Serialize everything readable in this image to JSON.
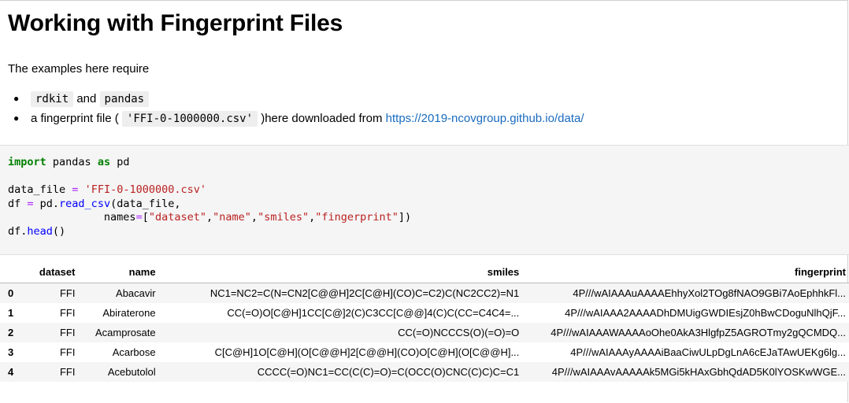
{
  "notebook": {
    "title": "Working with Fingerprint Files",
    "intro": "The examples here require",
    "requirements": {
      "item1": {
        "code1": "rdkit",
        "text1": " and ",
        "code2": "pandas"
      },
      "item2": {
        "text1": "a fingerprint file (",
        "code": "'FFI-0-1000000.csv'",
        "text2": ")here downloaded from ",
        "link": "https://2019-ncovgroup.github.io/data/"
      }
    }
  },
  "code_cell": {
    "line1": {
      "kw_import": "import",
      "mod": " pandas ",
      "kw_as": "as",
      "alias": " pd"
    },
    "line3": {
      "var": "data_file ",
      "eq": "=",
      "sp": " ",
      "str": "'FFI-0-1000000.csv'"
    },
    "line4": {
      "var": "df ",
      "eq": "=",
      "pre": " pd.",
      "fn": "read_csv",
      "args": "(data_file,"
    },
    "line5": {
      "indent": "               names",
      "eq": "=",
      "open": "[",
      "s1": "\"dataset\"",
      "s2": "\"name\"",
      "s3": "\"smiles\"",
      "s4": "\"fingerprint\"",
      "close": "])"
    },
    "line6": {
      "pre": "df.",
      "fn": "head",
      "post": "()"
    }
  },
  "dataframe": {
    "columns": [
      "",
      "dataset",
      "name",
      "smiles",
      "fingerprint"
    ],
    "rows": [
      [
        "0",
        "FFI",
        "Abacavir",
        "NC1=NC2=C(N=CN2[C@@H]2C[C@H](CO)C=C2)C(NC2CC2)=N1",
        "4P///wAIAAAuAAAAEhhyXol2TOg8fNAO9GBi7AoEphhkFl..."
      ],
      [
        "1",
        "FFI",
        "Abiraterone",
        "CC(=O)O[C@H]1CC[C@]2(C)C3CC[C@@]4(C)C(CC=C4C4=...",
        "4P///wAIAAA2AAAADhDMUigGWDIEsjZ0hBwCDoguNlhQjF..."
      ],
      [
        "2",
        "FFI",
        "Acamprosate",
        "CC(=O)NCCCS(O)(=O)=O",
        "4P///wAIAAAWAAAAoOhe0AkA3HlgfpZ5AGROTmy2gQCMDQ..."
      ],
      [
        "3",
        "FFI",
        "Acarbose",
        "C[C@H]1O[C@H](O[C@@H]2[C@@H](CO)O[C@H](O[C@@H]...",
        "4P///wAIAAAyAAAAiBaaCiwULpDgLnA6cEJaTAwUEKg6lg..."
      ],
      [
        "4",
        "FFI",
        "Acebutolol",
        "CCCC(=O)NC1=CC(C(C)=O)=C(OCC(O)CNC(C)C)C=C1",
        "4P///wAIAAAvAAAAAk5MGi5kHAxGbhQdAD5K0lYOSKwWGE..."
      ]
    ]
  }
}
